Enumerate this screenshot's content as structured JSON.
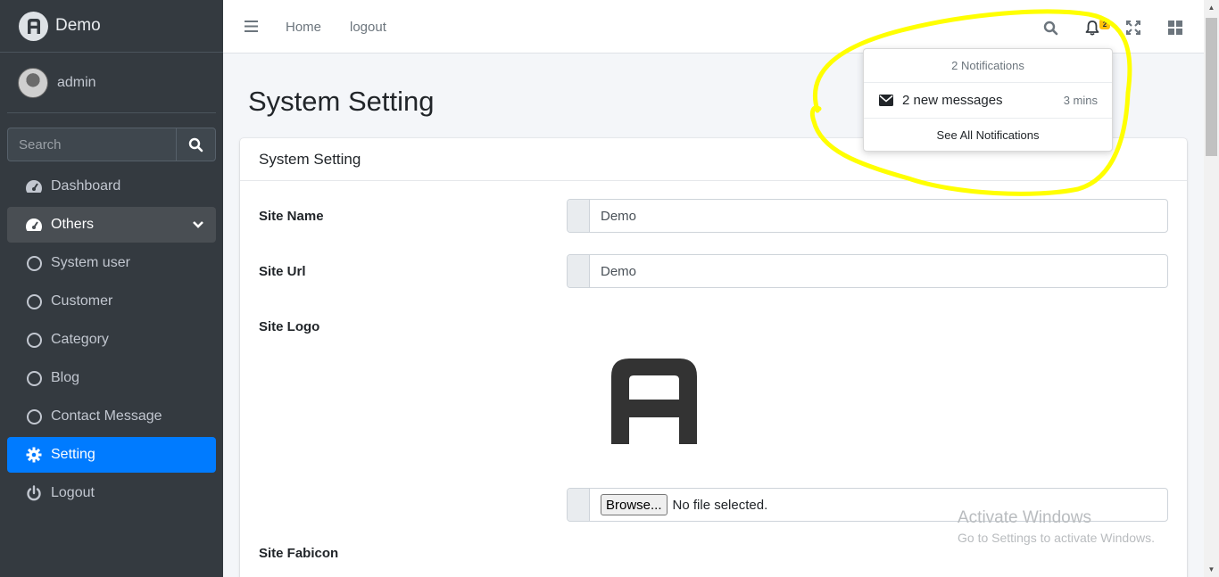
{
  "brand": {
    "name": "Demo"
  },
  "user": {
    "name": "admin"
  },
  "sidebar_search": {
    "placeholder": "Search"
  },
  "sidebar": {
    "items": [
      {
        "label": "Dashboard",
        "icon": "tachometer-icon"
      },
      {
        "label": "Others",
        "icon": "tachometer-icon"
      },
      {
        "label": "System user",
        "icon": "circle-icon"
      },
      {
        "label": "Customer",
        "icon": "circle-icon"
      },
      {
        "label": "Category",
        "icon": "circle-icon"
      },
      {
        "label": "Blog",
        "icon": "circle-icon"
      },
      {
        "label": "Contact Message",
        "icon": "circle-icon"
      },
      {
        "label": "Setting",
        "icon": "gear-icon"
      },
      {
        "label": "Logout",
        "icon": "power-icon"
      }
    ]
  },
  "topbar": {
    "links": [
      "Home",
      "logout"
    ],
    "notification_count": "2"
  },
  "page": {
    "title": "System Setting"
  },
  "card": {
    "title": "System Setting",
    "fields": {
      "site_name": {
        "label": "Site Name",
        "value": "Demo"
      },
      "site_url": {
        "label": "Site Url",
        "value": "Demo"
      },
      "site_logo": {
        "label": "Site Logo",
        "browse_label": "Browse...",
        "file_status": "No file selected."
      },
      "site_fabicon": {
        "label": "Site Fabicon"
      }
    }
  },
  "notifications": {
    "header": "2 Notifications",
    "items": [
      {
        "text": "2 new messages",
        "time": "3 mins",
        "icon": "envelope-icon"
      }
    ],
    "footer": "See All Notifications"
  },
  "watermark": {
    "title": "Activate Windows",
    "subtitle": "Go to Settings to activate Windows."
  },
  "colors": {
    "sidebar_bg": "#343a40",
    "active": "#007bff",
    "badge": "#ffc107",
    "annotation": "#ffff00"
  }
}
